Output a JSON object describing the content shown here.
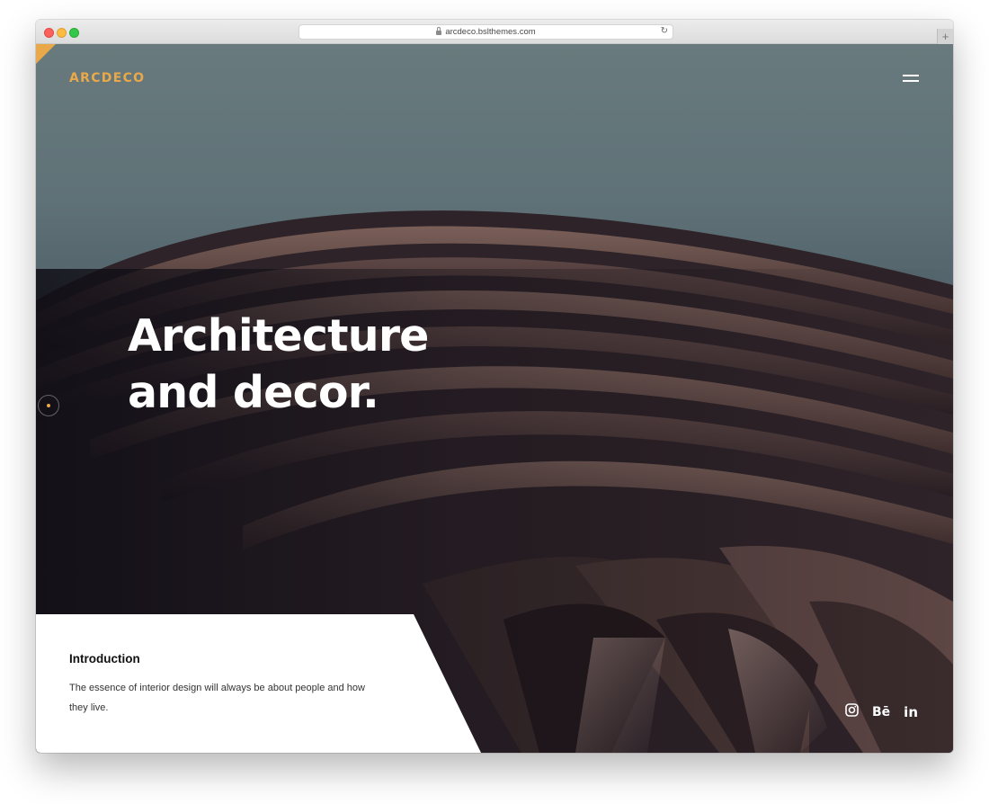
{
  "browser": {
    "url": "arcdeco.bslthemes.com",
    "new_tab_symbol": "+",
    "reload_symbol": "↻"
  },
  "brand": {
    "logo": "ARCDECO",
    "accent_color": "#e9a94a"
  },
  "hero": {
    "headline_line1": "Architecture",
    "headline_line2": "and decor."
  },
  "intro": {
    "title": "Introduction",
    "text": "The essence of interior design will always be about people and how they live."
  },
  "socials": {
    "instagram_icon": "instagram-icon",
    "behance_label": "Bē",
    "linkedin_label": "in"
  }
}
